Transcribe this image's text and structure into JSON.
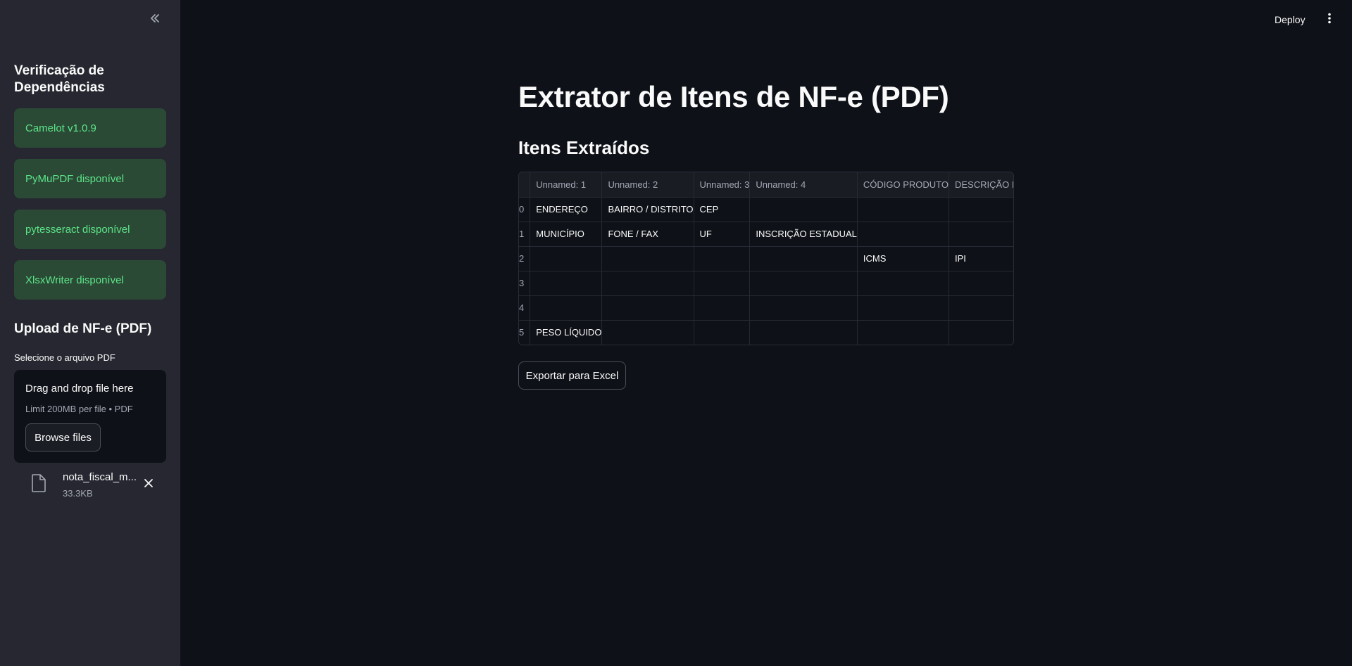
{
  "sidebar": {
    "title": "Verificação de Dependências",
    "dependencies": [
      "Camelot v1.0.9",
      "PyMuPDF disponível",
      "pytesseract disponível",
      "XlsxWriter disponível"
    ],
    "upload_title": "Upload de NF-e (PDF)",
    "upload_label": "Selecione o arquivo PDF",
    "dropzone_title": "Drag and drop file here",
    "dropzone_limit": "Limit 200MB per file • PDF",
    "browse_label": "Browse files",
    "file_name": "nota_fiscal_m...",
    "file_size": "33.3KB"
  },
  "header": {
    "deploy_label": "Deploy"
  },
  "main": {
    "title": "Extrator de Itens de NF-e (PDF)",
    "subtitle": "Itens Extraídos",
    "export_label": "Exportar para Excel",
    "table": {
      "columns": [
        "",
        "Unnamed: 1",
        "Unnamed: 2",
        "Unnamed: 3",
        "Unnamed: 4",
        "CÓDIGO PRODUTO",
        "DESCRIÇÃO DOS PRODUTO"
      ],
      "rows": [
        [
          "0",
          "ENDEREÇO",
          "BAIRRO / DISTRITO",
          "CEP",
          "",
          "",
          ""
        ],
        [
          "1",
          "MUNICÍPIO",
          "FONE / FAX",
          "UF",
          "INSCRIÇÃO ESTADUAL",
          "",
          ""
        ],
        [
          "2",
          "",
          "",
          "",
          "",
          "ICMS",
          "IPI"
        ],
        [
          "3",
          "",
          "",
          "",
          "",
          "",
          ""
        ],
        [
          "4",
          "",
          "",
          "",
          "",
          "",
          ""
        ],
        [
          "5",
          "PESO LÍQUIDO",
          "",
          "",
          "",
          "",
          ""
        ]
      ]
    }
  },
  "colors": {
    "background": "#0e1117",
    "sidebar": "#262730",
    "success_bg": "#2b4a36",
    "success_text": "#5ce488"
  }
}
